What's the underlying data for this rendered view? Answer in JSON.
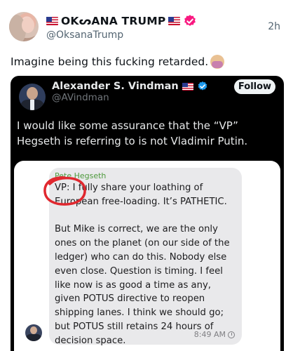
{
  "post": {
    "display_name": "OKᔕANA TRUMP",
    "handle": "@OksanaTrump",
    "timestamp": "2h",
    "text": "Imagine being this fucking retarded.",
    "emoji": "facepalm-emoji"
  },
  "quoted_post": {
    "author_name": "Alexander S. Vindman",
    "handle": "@AVindman",
    "follow_label": "Follow",
    "text": "I would like some assurance that the “VP” Hegseth is referring to is not Vladimir Putin."
  },
  "message_screenshot": {
    "sender": "Pete Hegseth",
    "body": "VP: I fully share your loathing of European free-loading. It’s PATHETIC.\n\nBut Mike is correct, we are the only ones on the planet (on our side of the ledger) who can do this. Nobody else even close. Question is timing. I feel like now is as good a time as any, given POTUS directive to reopen shipping lanes. I think we should go; but POTUS still retains 24 hours of decision space.",
    "time": "8:49 AM"
  },
  "colors": {
    "verified_badge": "#f91880",
    "verified_badge_blue": "#1d9bf0",
    "annotation_circle": "#e0282f"
  }
}
